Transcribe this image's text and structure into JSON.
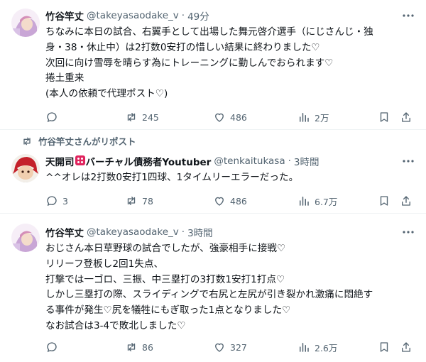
{
  "tweets": [
    {
      "name": "竹谷竿丈",
      "handle": "@takeyasaodake_v",
      "dot": "·",
      "time": "49分",
      "lines": [
        "ちなみに本日の試合、右翼手として出場した舞元啓介選手（にじさんじ・独",
        "身・38・休止中）は2打数0安打の惜しい結果に終わりました♡",
        "次回に向け雪辱を晴らす為にトレーニングに勤しんでおられます♡",
        "捲土重来",
        "(本人の依頼で代理ポスト♡)"
      ],
      "stats": {
        "reply": "",
        "repost": "245",
        "like": "486",
        "views": "2万"
      }
    },
    {
      "repost_note": "竹谷竿丈さんがリポスト",
      "name_before": "天開司",
      "name_after": "バーチャル債務者Youtuber",
      "handle": "@tenkaitukasa",
      "dot": "·",
      "time": "3時間",
      "lines": [
        "^^オレは2打数0安打1四球、1タイムリーエラーだった。"
      ],
      "stats": {
        "reply": "3",
        "repost": "78",
        "like": "486",
        "views": "6.7万"
      }
    },
    {
      "name": "竹谷竿丈",
      "handle": "@takeyasaodake_v",
      "dot": "·",
      "time": "3時間",
      "lines": [
        "おじさん本日草野球の試合でしたが、強豪相手に接戦♡",
        "リリーフ登板し2回1失点、",
        "打撃では一ゴロ、三振、中三塁打の3打数1安打1打点♡",
        "しかし三塁打の際、スライディングで右尻と左尻が引き裂かれ激痛に悶絶す",
        "る事件が発生♡尻を犠牲にもぎ取った1点となりました♡",
        "なお試合は3-4で敗北しました♡"
      ],
      "stats": {
        "reply": "",
        "repost": "86",
        "like": "327",
        "views": "2.6万"
      }
    }
  ],
  "icons": [
    "more-icon",
    "reply-icon",
    "repost-icon",
    "like-icon",
    "views-icon",
    "bookmark-icon",
    "share-icon"
  ],
  "colors": {
    "text": "#0f1419",
    "secondary": "#536471",
    "divider": "#eff3f4"
  }
}
